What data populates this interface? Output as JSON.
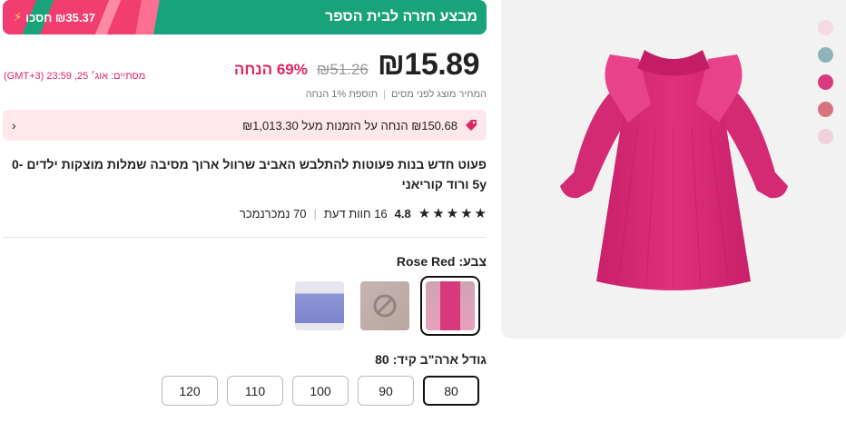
{
  "promo": {
    "savings": "₪35.37 חסכו",
    "return_text": "מבצע חזרה לבית הספר"
  },
  "price": {
    "current": "₪15.89",
    "original": "₪51.26",
    "discount": "69% הנחה",
    "ends": "מסתיים: אוג׳ 25, 23:59 (GMT+3)",
    "tax_note": "המחיר מוצג לפני מסים",
    "tax_extra": "תוספת 1% הנחה"
  },
  "coupon": {
    "text": "₪150.68 הנחה על הזמנות מעל ₪1,013.30"
  },
  "product": {
    "title": "פעוט חדש בנות פעוטות להתלבש האביב שרוול ארוך מסיבה שמלות מוצקות ילדים 0-5y ורוד קוריאני"
  },
  "rating": {
    "value": "4.8",
    "reviews": "16 חוות דעת",
    "sold": "70 נמכרנמכר"
  },
  "color": {
    "label": "צבע:",
    "selected": "Rose Red"
  },
  "size": {
    "label": "גודל ארה\"ב קיד:",
    "selected": "80",
    "options": [
      "80",
      "90",
      "100",
      "110",
      "120"
    ]
  },
  "colors": {
    "dress": "#e0317a",
    "accent": "#e0245e",
    "promo_green": "#1aa37a",
    "promo_pink": "#f23d71",
    "dots": [
      "#f6d9e3",
      "#8fb3b8",
      "#d93a7e",
      "#d9747e",
      "#f0d2dc"
    ]
  }
}
